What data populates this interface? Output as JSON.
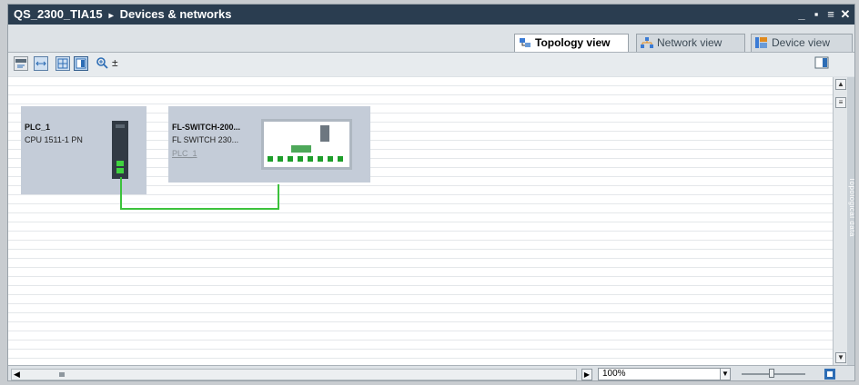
{
  "window": {
    "project": "QS_2300_TIA15",
    "separator": "▸",
    "title": "Devices & networks",
    "controls": [
      "_",
      "▪",
      "≡",
      "✕"
    ]
  },
  "tabs": [
    {
      "label": "Topology view",
      "active": true,
      "icon": "topology-icon"
    },
    {
      "label": "Network view",
      "active": false,
      "icon": "network-icon"
    },
    {
      "label": "Device view",
      "active": false,
      "icon": "device-icon"
    }
  ],
  "toolbar": {
    "buttons": [
      "hardware-sync-icon",
      "fit-icon",
      "grid-icon",
      "overview-icon",
      "zoom-icon"
    ],
    "zoom_suffix": "±"
  },
  "devices": [
    {
      "name": "PLC_1",
      "type": "CPU 1511-1 PN",
      "subnet": ""
    },
    {
      "name": "FL-SWITCH-200...",
      "type": "FL SWITCH 230...",
      "subnet": "PLC_1"
    }
  ],
  "side_panel": {
    "label": "Topological data"
  },
  "statusbar": {
    "zoom_value": "100%"
  },
  "colors": {
    "link": "#3cc23c",
    "device_bg": "#c4ccd8",
    "titlebar": "#2a3d50"
  }
}
